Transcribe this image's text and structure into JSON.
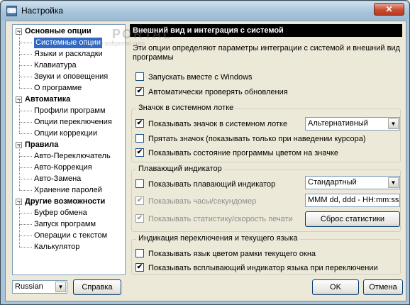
{
  "window": {
    "title": "Настройка",
    "close_glyph": "✕"
  },
  "tree": {
    "items": [
      {
        "label": "Основные опции",
        "level": 0,
        "expanded": true
      },
      {
        "label": "Системные опции",
        "level": 1,
        "selected": true
      },
      {
        "label": "Языки и раскладки",
        "level": 1
      },
      {
        "label": "Клавиатура",
        "level": 1
      },
      {
        "label": "Звуки и оповещения",
        "level": 1
      },
      {
        "label": "О программе",
        "level": 1
      },
      {
        "label": "Автоматика",
        "level": 0,
        "expanded": true
      },
      {
        "label": "Профили программ",
        "level": 1
      },
      {
        "label": "Опции переключения",
        "level": 1
      },
      {
        "label": "Опции коррекции",
        "level": 1
      },
      {
        "label": "Правила",
        "level": 0,
        "expanded": true
      },
      {
        "label": "Авто-Переключатель",
        "level": 1
      },
      {
        "label": "Авто-Коррекция",
        "level": 1
      },
      {
        "label": "Авто-Замена",
        "level": 1
      },
      {
        "label": "Хранение паролей",
        "level": 1
      },
      {
        "label": "Другие возможности",
        "level": 0,
        "expanded": true
      },
      {
        "label": "Буфер обмена",
        "level": 1
      },
      {
        "label": "Запуск программ",
        "level": 1
      },
      {
        "label": "Операции с текстом",
        "level": 1
      },
      {
        "label": "Калькулятор",
        "level": 1
      }
    ]
  },
  "panel": {
    "header": "Внешний вид и интеграция с системой",
    "description": "Эти опции определяют параметры интеграции с системой и внешний вид программы",
    "general": {
      "startup_label": "Запускать вместе с Windows",
      "startup_checked": false,
      "updates_label": "Автоматически проверять обновления",
      "updates_checked": true
    },
    "tray_group": {
      "title": "Значок в системном лотке",
      "show_icon_label": "Показывать значок в системном лотке",
      "show_icon_checked": true,
      "icon_style_value": "Альтернативный",
      "hide_icon_label": "Прятать значок (показывать только при наведении курсора)",
      "hide_icon_checked": false,
      "show_state_label": "Показывать состояние программы цветом на значке",
      "show_state_checked": true
    },
    "floating_group": {
      "title": "Плавающий индикатор",
      "show_floating_label": "Показывать плавающий индикатор",
      "show_floating_checked": false,
      "floating_style_value": "Стандартный",
      "show_clock_label": "Показывать часы/секундомер",
      "show_clock_checked": true,
      "clock_format_value": "MMM dd, ddd - HH:mm:ss",
      "show_stats_label": "Показывать статистику/скорость печати",
      "show_stats_checked": true,
      "reset_stats_label": "Сброс статистики"
    },
    "lang_group": {
      "title": "Индикация переключения и текущего языка",
      "frame_color_label": "Показывать язык цветом рамки текущего окна",
      "frame_color_checked": false,
      "popup_label": "Показывать всплывающий индикатор языка при переключении",
      "popup_checked": true
    }
  },
  "bottom": {
    "language_value": "Russian",
    "help_label": "Справка",
    "ok_label": "OK",
    "cancel_label": "Отмена"
  },
  "watermark": {
    "text": "PORTAL",
    "subtext": "www.softportal.com"
  },
  "glyphs": {
    "check": "✔",
    "dropdown": "▼",
    "minus": "−"
  }
}
